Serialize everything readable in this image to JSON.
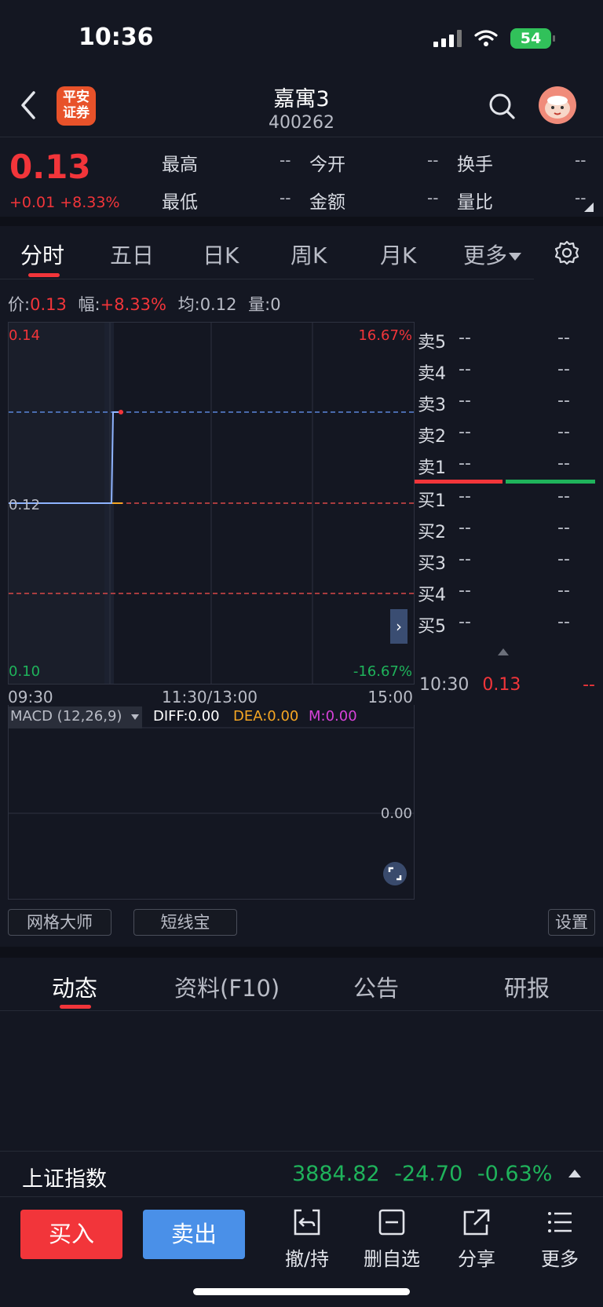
{
  "status_bar": {
    "time": "10:36",
    "battery": "54"
  },
  "header": {
    "brand_logo_text": "平安证券",
    "stock_name": "嘉寓3",
    "stock_code": "400262"
  },
  "quote": {
    "price": "0.13",
    "change": "+0.01 +8.33%",
    "fields": [
      {
        "label": "最高",
        "value": "--"
      },
      {
        "label": "今开",
        "value": "--"
      },
      {
        "label": "换手",
        "value": "--"
      },
      {
        "label": "最低",
        "value": "--"
      },
      {
        "label": "金额",
        "value": "--"
      },
      {
        "label": "量比",
        "value": "--"
      }
    ]
  },
  "period_tabs": [
    {
      "label": "分时",
      "active": true
    },
    {
      "label": "五日"
    },
    {
      "label": "日K"
    },
    {
      "label": "周K"
    },
    {
      "label": "月K"
    },
    {
      "label": "更多"
    }
  ],
  "info_line": {
    "price_label": "价:",
    "price_value": "0.13",
    "amp_label": "幅:",
    "amp_value": "+8.33%",
    "avg_label": "均:",
    "avg_value": "0.12",
    "vol_label": "量:",
    "vol_value": "0"
  },
  "chart": {
    "y_top": "0.14",
    "y_mid": "0.12",
    "y_bottom": "0.10",
    "pct_top": "16.67%",
    "pct_bottom": "-16.67%",
    "x_labels": [
      "09:30",
      "11:30/13:00",
      "15:00"
    ],
    "macd_label": "MACD (12,26,9)",
    "macd_diff": "DIFF:0.00",
    "macd_dea": "DEA:0.00",
    "macd_m": "M:0.00",
    "macd_zero": "0.00",
    "colors": {
      "up": "#f2353a",
      "down": "#1fb35b",
      "price_line": "#8fb4ff",
      "avg_line": "#f5a623"
    }
  },
  "order_book": {
    "sell": [
      {
        "label": "卖5",
        "price": "--",
        "vol": "--"
      },
      {
        "label": "卖4",
        "price": "--",
        "vol": "--"
      },
      {
        "label": "卖3",
        "price": "--",
        "vol": "--"
      },
      {
        "label": "卖2",
        "price": "--",
        "vol": "--"
      },
      {
        "label": "卖1",
        "price": "--",
        "vol": "--"
      }
    ],
    "buy": [
      {
        "label": "买1",
        "price": "--",
        "vol": "--"
      },
      {
        "label": "买2",
        "price": "--",
        "vol": "--"
      },
      {
        "label": "买3",
        "price": "--",
        "vol": "--"
      },
      {
        "label": "买4",
        "price": "--",
        "vol": "--"
      },
      {
        "label": "买5",
        "price": "--",
        "vol": "--"
      }
    ],
    "trade": {
      "time": "10:30",
      "price": "0.13",
      "vol": "--"
    }
  },
  "tools": {
    "grid_master": "网格大师",
    "short_line": "短线宝",
    "settings": "设置"
  },
  "content_tabs": [
    {
      "label": "动态",
      "active": true
    },
    {
      "label": "资料(F10)"
    },
    {
      "label": "公告"
    },
    {
      "label": "研报"
    }
  ],
  "index_bar": {
    "name": "上证指数",
    "value": "3884.82",
    "change": "-24.70",
    "pct": "-0.63%"
  },
  "actions": {
    "buy": "买入",
    "sell": "卖出",
    "cancel": "撤/持",
    "remove_watch": "删自选",
    "share": "分享",
    "more": "更多"
  }
}
